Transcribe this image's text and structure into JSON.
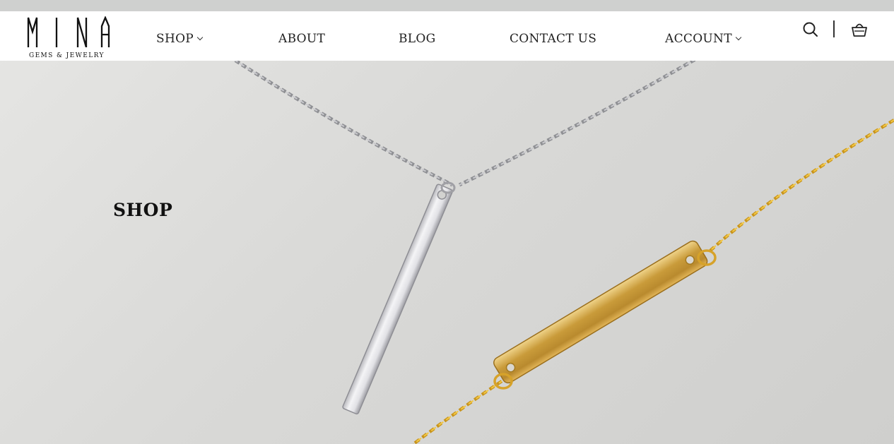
{
  "brand": {
    "name": "MINA",
    "tagline": "GEMS & JEWELRY"
  },
  "nav": {
    "items": [
      {
        "label": "SHOP",
        "has_dropdown": true
      },
      {
        "label": "ABOUT",
        "has_dropdown": false
      },
      {
        "label": "BLOG",
        "has_dropdown": false
      },
      {
        "label": "CONTACT US",
        "has_dropdown": false
      },
      {
        "label": "ACCOUNT",
        "has_dropdown": true
      }
    ],
    "icons": [
      "search-icon",
      "shopping-basket-icon"
    ]
  },
  "hero": {
    "heading": "SHOP",
    "image": "silver-and-gold-bar-necklaces"
  },
  "colors": {
    "nav_background": "#ffffff",
    "text": "#222222",
    "hero_background": "#dcdcdb",
    "silver": "#d9d9de",
    "gold": "#d9a826"
  }
}
